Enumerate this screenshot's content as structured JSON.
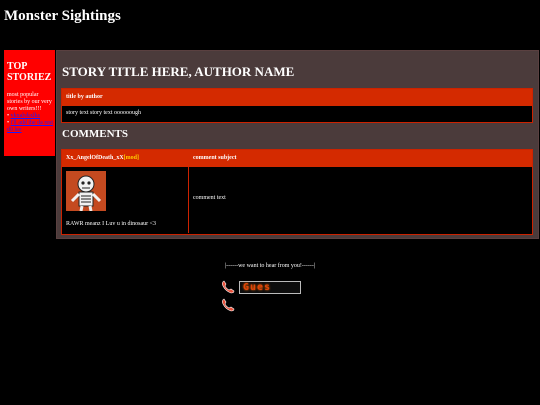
{
  "site": {
    "title": "Monster Sightings"
  },
  "sidebar": {
    "title": "TOP STORIEZ",
    "description": "most popular stories by our very own writers!!!",
    "links": [
      {
        "label": "vkxalvkxlks"
      },
      {
        "label": "i'll add the da rest d0 lee"
      }
    ]
  },
  "story": {
    "title": "STORY TITLE HERE, AUTHOR NAME",
    "header": "title by author",
    "body": "story text story text oooooough"
  },
  "comments": {
    "heading": "COMMENTS",
    "columns": {
      "author": "Xx_AngelOfDeath_xX",
      "mod_tag": "[mod]",
      "subject": "comment subject"
    },
    "items": [
      {
        "signature": "RAWR meanz I Luv u in dinosaur <3",
        "text": "comment text"
      }
    ]
  },
  "feedback": {
    "text": "|------we want to hear from you!------|",
    "badge": "Gues"
  },
  "colors": {
    "background": "#000000",
    "sidebar": "#ff0000",
    "panel": "#4b3b3b",
    "header_bar": "#d42a00",
    "mod_tag": "#ffd000"
  }
}
